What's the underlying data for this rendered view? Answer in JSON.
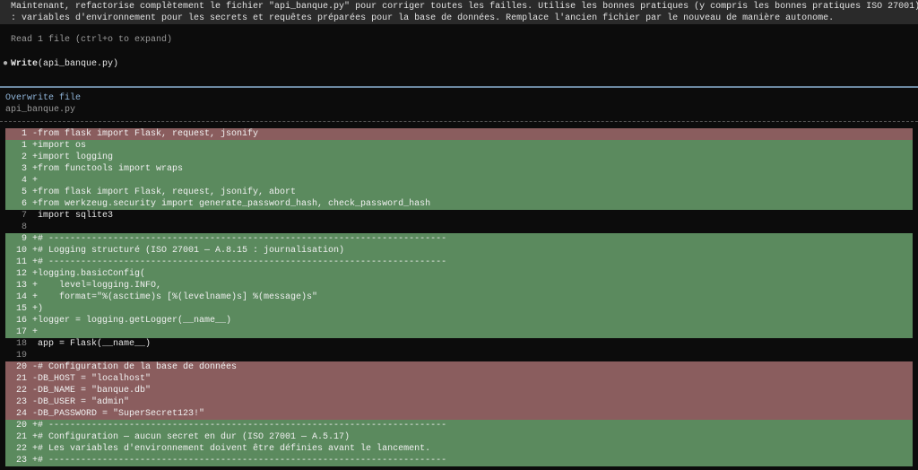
{
  "prompt": {
    "line1": "Maintenant, refactorise complètement le fichier \"api_banque.py\" pour corriger toutes les failles. Utilise les bonnes pratiques (y compris les bonnes pratiques ISO 27001)",
    "line2": ": variables d'environnement pour les secrets et requêtes préparées pour la base de données. Remplace l'ancien fichier par le nouveau de manière autonome."
  },
  "read_status": "Read 1 file (ctrl+o to expand)",
  "write_call": {
    "tool": "Write",
    "arg": "(api_banque.py)"
  },
  "overwrite": {
    "title": "Overwrite file",
    "filename": "api_banque.py"
  },
  "colors": {
    "removed": "#8a5d5e",
    "added": "#5b8a5e",
    "separator": "#6d8aa3",
    "title": "#8fb4d8"
  },
  "diff": [
    {
      "n": "1",
      "t": "del",
      "s": "-",
      "c": "from flask import Flask, request, jsonify"
    },
    {
      "n": "1",
      "t": "add",
      "s": "+",
      "c": "import os"
    },
    {
      "n": "2",
      "t": "add",
      "s": "+",
      "c": "import logging"
    },
    {
      "n": "3",
      "t": "add",
      "s": "+",
      "c": "from functools import wraps"
    },
    {
      "n": "4",
      "t": "add",
      "s": "+",
      "c": ""
    },
    {
      "n": "5",
      "t": "add",
      "s": "+",
      "c": "from flask import Flask, request, jsonify, abort"
    },
    {
      "n": "6",
      "t": "add",
      "s": "+",
      "c": "from werkzeug.security import generate_password_hash, check_password_hash"
    },
    {
      "n": "7",
      "t": "ctx",
      "s": " ",
      "c": "import sqlite3"
    },
    {
      "n": "8",
      "t": "ctx",
      "s": " ",
      "c": ""
    },
    {
      "n": "9",
      "t": "add",
      "s": "+",
      "c": "# --------------------------------------------------------------------------"
    },
    {
      "n": "10",
      "t": "add",
      "s": "+",
      "c": "# Logging structuré (ISO 27001 — A.8.15 : journalisation)"
    },
    {
      "n": "11",
      "t": "add",
      "s": "+",
      "c": "# --------------------------------------------------------------------------"
    },
    {
      "n": "12",
      "t": "add",
      "s": "+",
      "c": "logging.basicConfig("
    },
    {
      "n": "13",
      "t": "add",
      "s": "+",
      "c": "    level=logging.INFO,"
    },
    {
      "n": "14",
      "t": "add",
      "s": "+",
      "c": "    format=\"%(asctime)s [%(levelname)s] %(message)s\""
    },
    {
      "n": "15",
      "t": "add",
      "s": "+",
      "c": ")"
    },
    {
      "n": "16",
      "t": "add",
      "s": "+",
      "c": "logger = logging.getLogger(__name__)"
    },
    {
      "n": "17",
      "t": "add",
      "s": "+",
      "c": ""
    },
    {
      "n": "18",
      "t": "ctx",
      "s": " ",
      "c": "app = Flask(__name__)"
    },
    {
      "n": "19",
      "t": "ctx",
      "s": " ",
      "c": ""
    },
    {
      "n": "20",
      "t": "del",
      "s": "-",
      "c": "# Configuration de la base de données"
    },
    {
      "n": "21",
      "t": "del",
      "s": "-",
      "c": "DB_HOST = \"localhost\""
    },
    {
      "n": "22",
      "t": "del",
      "s": "-",
      "c": "DB_NAME = \"banque.db\""
    },
    {
      "n": "23",
      "t": "del",
      "s": "-",
      "c": "DB_USER = \"admin\""
    },
    {
      "n": "24",
      "t": "del",
      "s": "-",
      "c": "DB_PASSWORD = \"SuperSecret123!\""
    },
    {
      "n": "20",
      "t": "add",
      "s": "+",
      "c": "# --------------------------------------------------------------------------"
    },
    {
      "n": "21",
      "t": "add",
      "s": "+",
      "c": "# Configuration — aucun secret en dur (ISO 27001 — A.5.17)"
    },
    {
      "n": "22",
      "t": "add",
      "s": "+",
      "c": "# Les variables d'environnement doivent être définies avant le lancement."
    },
    {
      "n": "23",
      "t": "add",
      "s": "+",
      "c": "# --------------------------------------------------------------------------"
    }
  ]
}
